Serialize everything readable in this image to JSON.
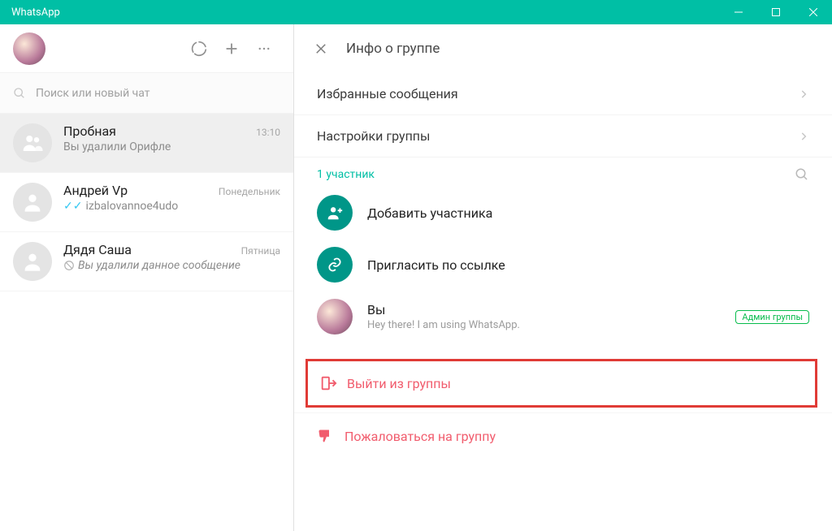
{
  "window": {
    "title": "WhatsApp"
  },
  "sidebar": {
    "search_placeholder": "Поиск или новый чат",
    "chats": [
      {
        "name": "Пробная",
        "time": "13:10",
        "subtitle": "Вы удалили Орифле"
      },
      {
        "name": "Андрей Vp",
        "time": "Понедельник",
        "subtitle": "izbalovannoe4udo"
      },
      {
        "name": "Дядя Саша",
        "time": "Пятница",
        "subtitle": "Вы удалили данное сообщение"
      }
    ]
  },
  "info": {
    "header_title": "Инфо о группе",
    "starred_label": "Избранные сообщения",
    "settings_label": "Настройки группы",
    "participants_count_label": "1 участник",
    "add_participant_label": "Добавить участника",
    "invite_link_label": "Пригласить по ссылке",
    "you_label": "Вы",
    "you_status": "Hey there! I am using WhatsApp.",
    "admin_badge": "Админ группы",
    "exit_group_label": "Выйти из группы",
    "report_group_label": "Пожаловаться на группу"
  }
}
